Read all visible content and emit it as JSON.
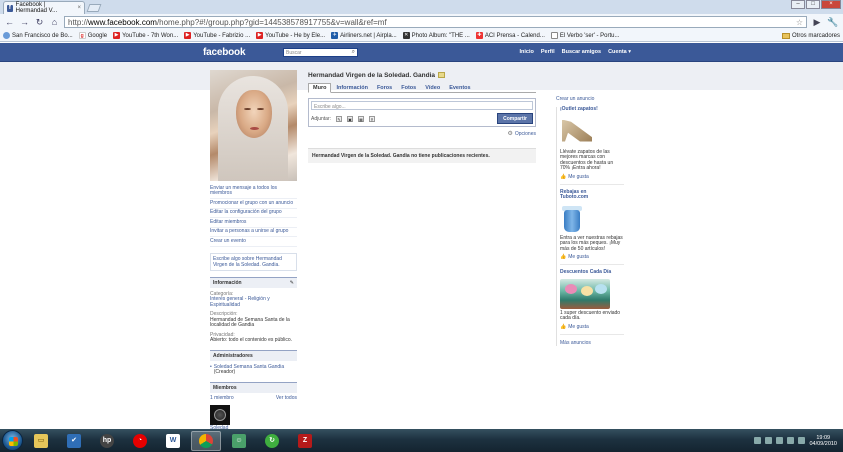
{
  "browser": {
    "tab_title": "Facebook | Hermandad V...",
    "tab_close": "×",
    "url_scheme": "http://",
    "url_host": "www.facebook.com",
    "url_path": "/home.php?#!/group.php?gid=144538578917755&v=wall&ref=mf",
    "window_controls": [
      "–",
      "□",
      "×"
    ],
    "bookmarks": [
      {
        "label": "San Francisco de Bo...",
        "icon": "globe"
      },
      {
        "label": "Google",
        "icon": "google"
      },
      {
        "label": "YouTube - 7th Won...",
        "icon": "youtube"
      },
      {
        "label": "YouTube - Fabrizio ...",
        "icon": "youtube"
      },
      {
        "label": "YouTube - He by Ele...",
        "icon": "youtube"
      },
      {
        "label": "Airliners.net | Airpla...",
        "icon": "airplane"
      },
      {
        "label": "Photo Album: \"THE ...",
        "icon": "x"
      },
      {
        "label": "ACI Prensa - Calend...",
        "icon": "aci"
      },
      {
        "label": "El Verbo 'ser' - Portu...",
        "icon": "doc"
      }
    ],
    "other_bookmarks": "Otros marcadores"
  },
  "fb": {
    "logo": "facebook",
    "search_placeholder": "Buscar",
    "nav": [
      "Inicio",
      "Perfil",
      "Buscar amigos",
      "Cuenta ▾"
    ]
  },
  "group": {
    "title": "Hermandad Virgen de la Soledad. Gandia",
    "tabs": [
      "Muro",
      "Información",
      "Foros",
      "Fotos",
      "Vídeo",
      "Eventos"
    ],
    "active_tab": "Muro",
    "composer_placeholder": "Escribe algo...",
    "attach_label": "Adjuntar:",
    "share_button": "Compartir",
    "options_link": "Opciones",
    "no_stories": "Hermandad Virgen de la Soledad. Gandia no tiene publicaciones recientes."
  },
  "left": {
    "actions": [
      "Enviar un mensaje a todos los miembros",
      "Promocionar el grupo con un anuncio",
      "Editar la configuración del grupo",
      "Editar miembros",
      "Invitar a personas a unirse al grupo",
      "Crear un evento"
    ],
    "write_box": "Escribe algo sobre Hermandad Virgen de la Soledad. Gandia.",
    "info": {
      "heading": "Información",
      "edit_icon": "✎",
      "category_label": "Categoría:",
      "category_value": "Interés general - Religión y Espiritualidad",
      "description_label": "Descripción:",
      "description_value": "Hermandad de Semana Santa de la localidad de Gandia",
      "privacy_label": "Privacidad:",
      "privacy_value": "Abierto: todo el contenido es público."
    },
    "admins": {
      "heading": "Administradores",
      "name": "Soledad Semana Santa Gandia",
      "role": "(Creador)"
    },
    "members": {
      "heading": "Miembros",
      "count": "1 miembro",
      "see_all": "Ver todos",
      "member_name": "Soledad Semana Santa"
    }
  },
  "right": {
    "create_ad": "Crear un anuncio",
    "ads": [
      {
        "title": "¡Outlet zapatos!",
        "sub": "",
        "text": "Llévate zapatos de las mejores marcas con descuentos de hasta un 70% ¡Entra ahora!",
        "like": "Me gusta"
      },
      {
        "title": "Rebajas en",
        "sub": "Tuboto.com",
        "text": "Entra a ver nuestras rebajas para los más peques. ¡Muy más de 50 artículos!",
        "like": "Me gusta"
      },
      {
        "title": "Descuentos Cada Día",
        "sub": "",
        "text": "1 super descuento enviado cada día.",
        "like": "Me gusta"
      }
    ],
    "more_ads": "Más anuncios"
  },
  "taskbar": {
    "clock_time": "19:09",
    "clock_date": "04/09/2010"
  },
  "colors": {
    "fb_blue": "#3b5998",
    "fb_link": "#3b5998",
    "taskbar": "#1d3140"
  }
}
